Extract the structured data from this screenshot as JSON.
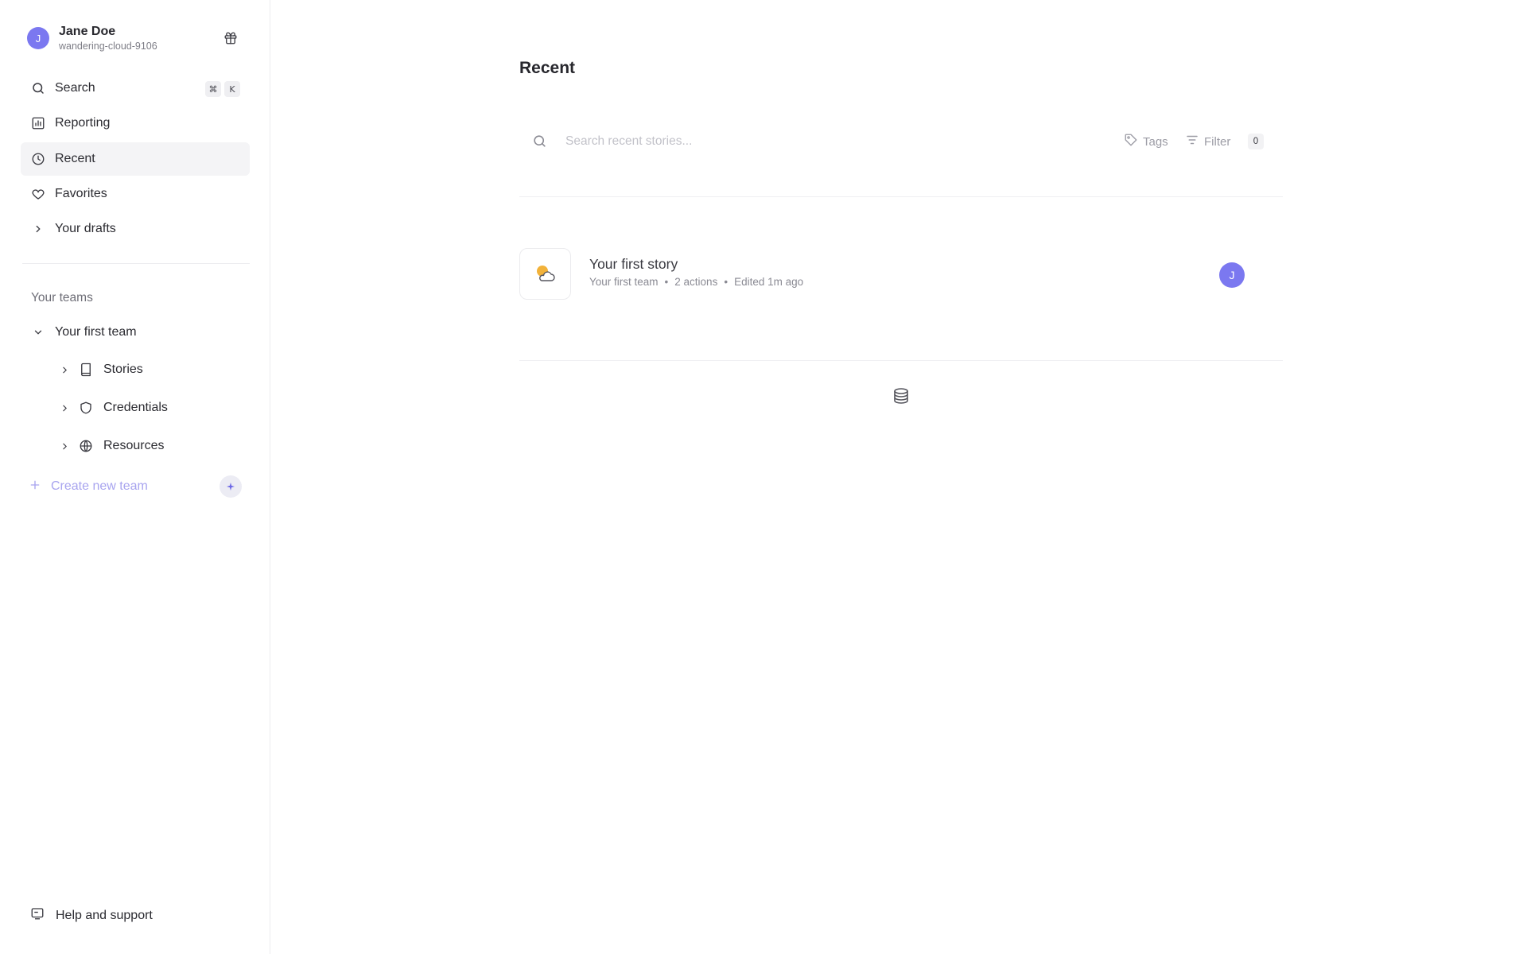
{
  "user": {
    "initial": "J",
    "name": "Jane Doe",
    "handle": "wandering-cloud-9106"
  },
  "nav": {
    "search_label": "Search",
    "search_shortcut": [
      "⌘",
      "K"
    ],
    "reporting_label": "Reporting",
    "recent_label": "Recent",
    "favorites_label": "Favorites",
    "drafts_label": "Your drafts"
  },
  "teams": {
    "section_label": "Your teams",
    "team_name": "Your first team",
    "items": [
      {
        "label": "Stories",
        "icon": "book-icon"
      },
      {
        "label": "Credentials",
        "icon": "shield-icon"
      },
      {
        "label": "Resources",
        "icon": "globe-icon"
      }
    ],
    "create_label": "Create new team"
  },
  "footer": {
    "help_label": "Help and support"
  },
  "main": {
    "title": "Recent",
    "search_placeholder": "Search recent stories...",
    "tags_label": "Tags",
    "filter_label": "Filter",
    "filter_count": "0"
  },
  "stories": [
    {
      "title": "Your first story",
      "team": "Your first team",
      "actions": "2 actions",
      "edited": "Edited 1m ago",
      "owner_initial": "J"
    }
  ],
  "colors": {
    "accent": "#7b78f0",
    "active_bg": "#f4f4f6",
    "create_team": "#a8a4ef"
  }
}
